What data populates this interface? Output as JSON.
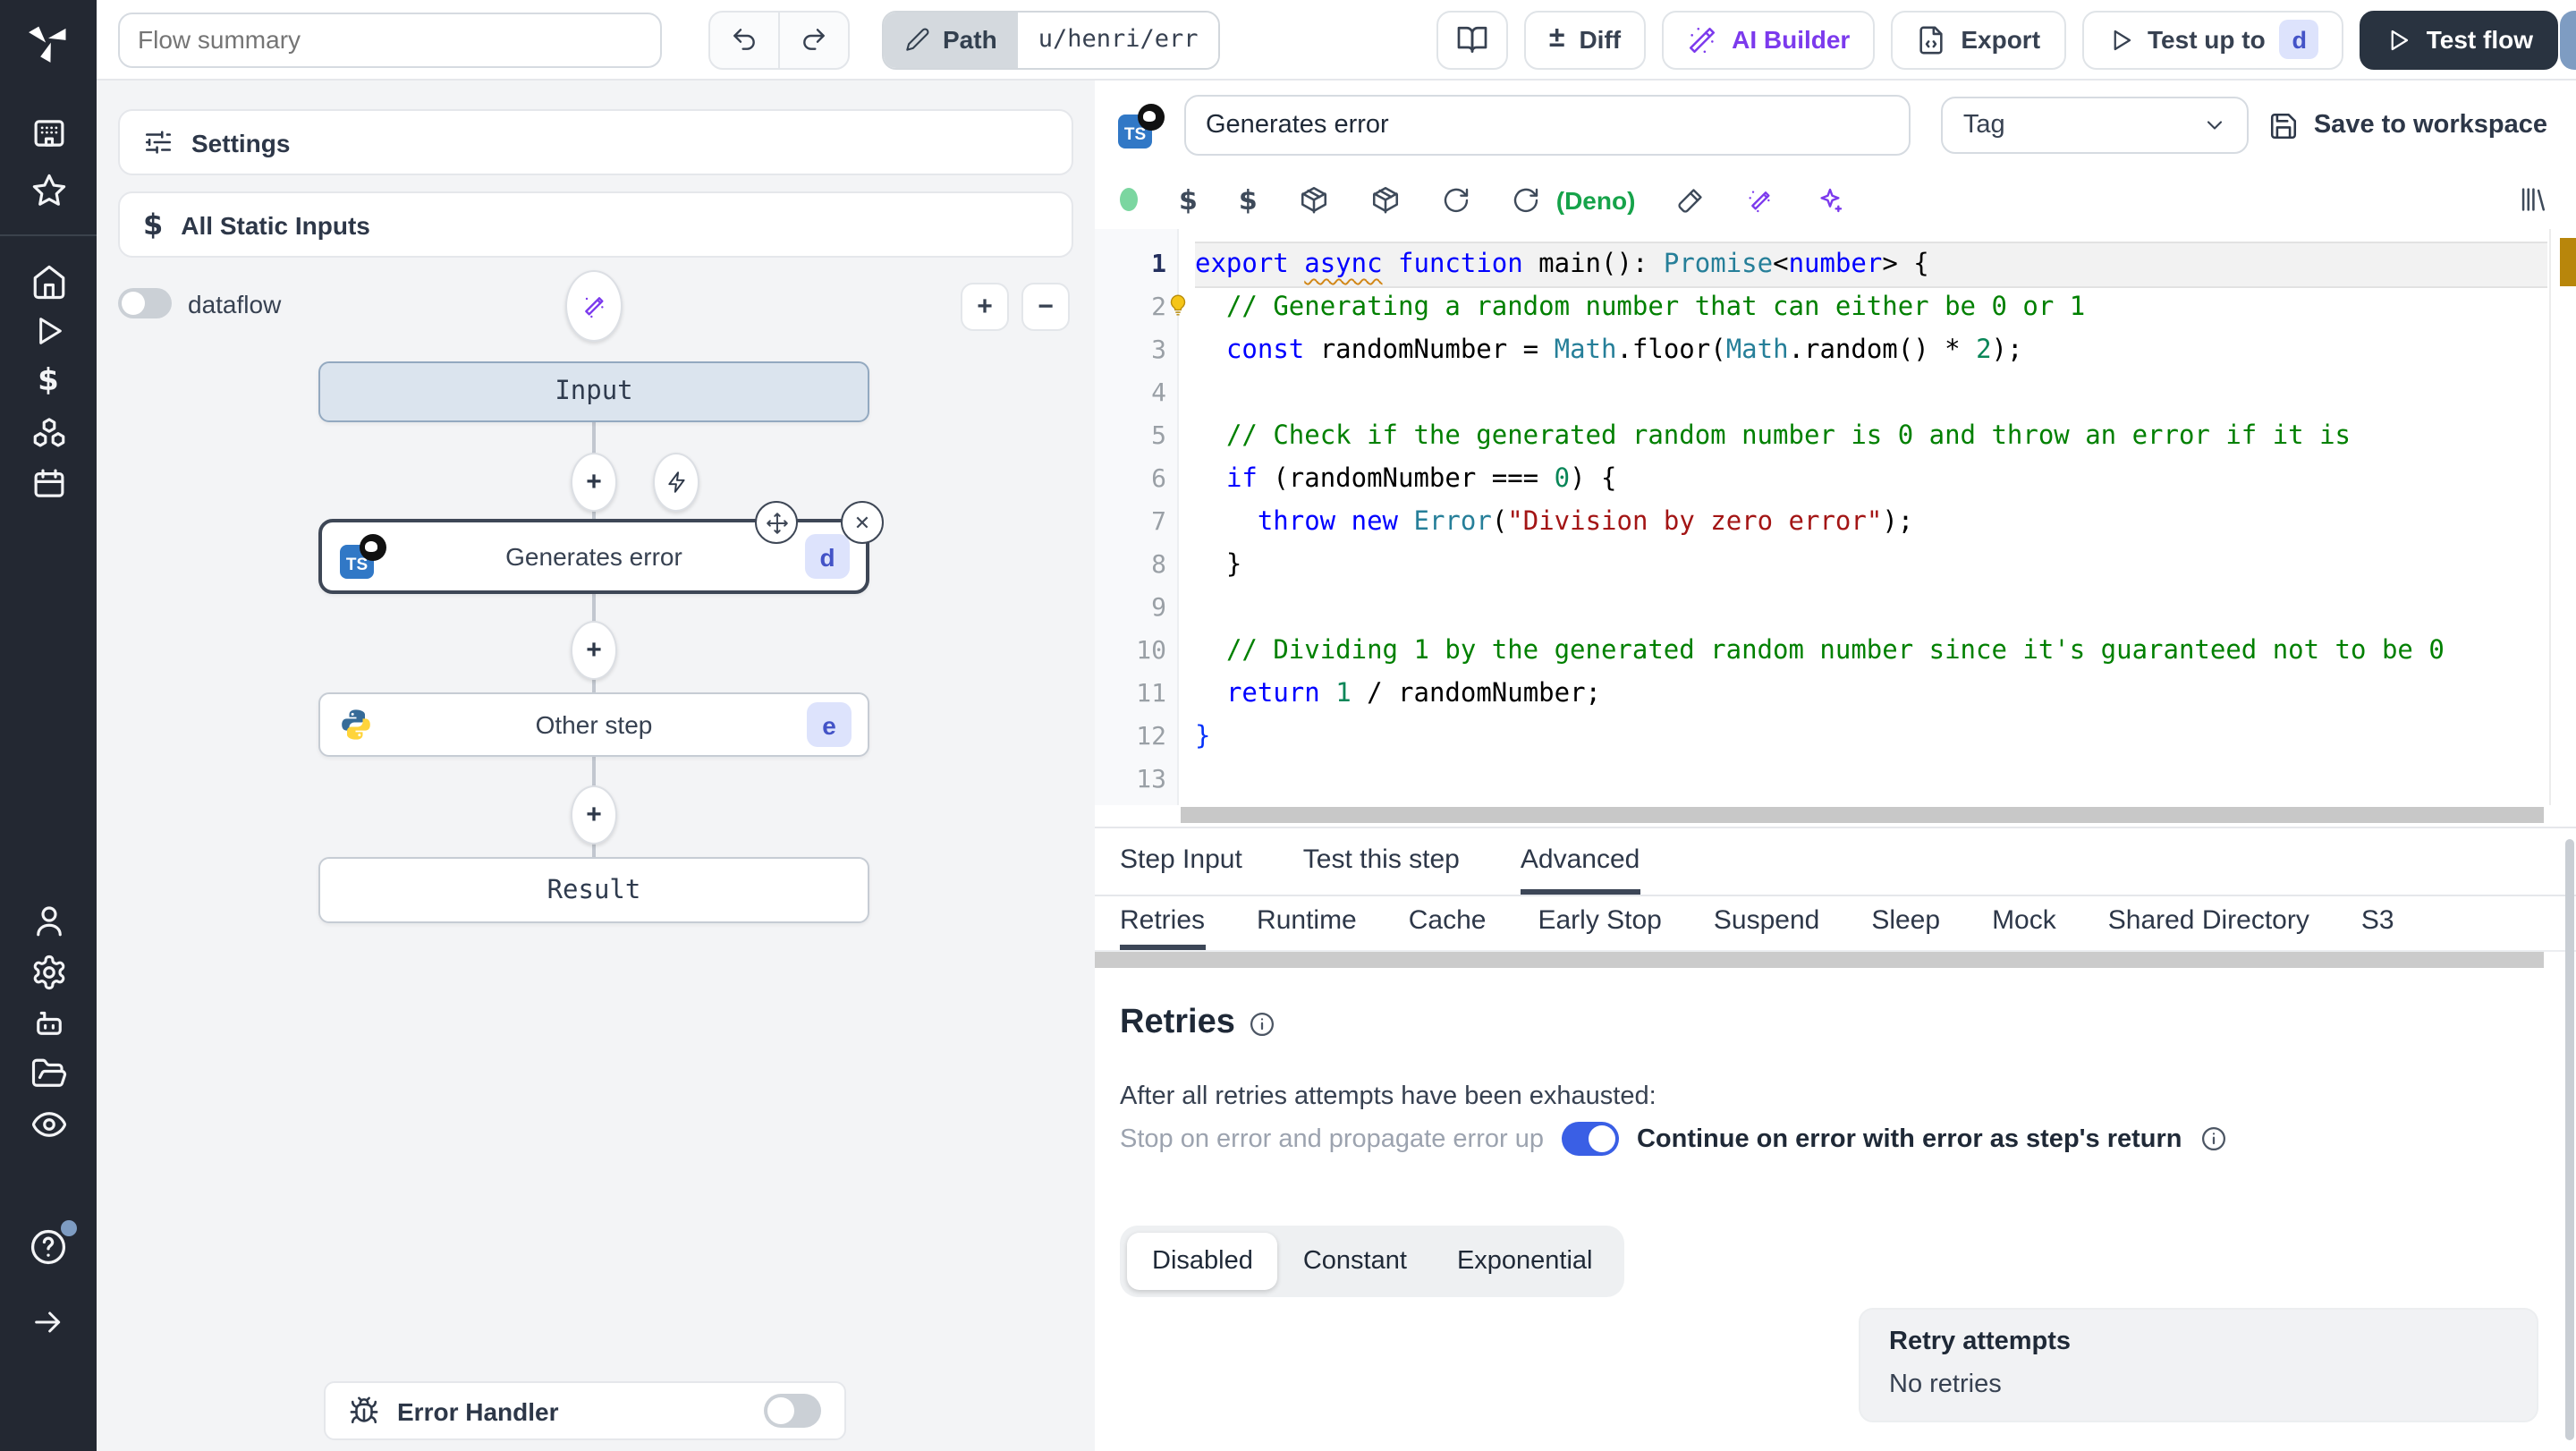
{
  "topbar": {
    "flow_summary_placeholder": "Flow summary",
    "path_label": "Path",
    "path_value": "u/henri/err",
    "diff_label": "Diff",
    "ai_builder_label": "AI Builder",
    "export_label": "Export",
    "test_up_to_label": "Test up to",
    "test_up_to_badge": "d",
    "test_flow_label": "Test flow"
  },
  "icons": {
    "diff_glyph": "±",
    "plus_glyph": "+",
    "minus_glyph": "−",
    "close_glyph": "✕",
    "help_glyph": "?",
    "dollar_glyph": "$"
  },
  "flow_panel": {
    "settings_label": "Settings",
    "static_inputs_label": "All Static Inputs",
    "dataflow_label": "dataflow",
    "nodes": {
      "input_label": "Input",
      "step1_label": "Generates error",
      "step1_badge": "d",
      "step1_lang": "TS",
      "step2_label": "Other step",
      "step2_badge": "e",
      "result_label": "Result"
    },
    "error_handler_label": "Error Handler"
  },
  "step_editor": {
    "lang_badge": "TS",
    "name_value": "Generates error",
    "tag_placeholder": "Tag",
    "save_label": "Save to workspace",
    "runtime_label": "(Deno)",
    "code": {
      "lines": [
        [
          [
            "kw",
            "export"
          ],
          [
            "pl",
            " "
          ],
          [
            "kw warn",
            "async"
          ],
          [
            "pl",
            " "
          ],
          [
            "kw",
            "function"
          ],
          [
            "pl",
            " main"
          ],
          [
            "pl",
            "(): "
          ],
          [
            "ty",
            "Promise"
          ],
          [
            "pl",
            "<"
          ],
          [
            "kw",
            "number"
          ],
          [
            "pl",
            "> {"
          ]
        ],
        [
          [
            "pl",
            "  "
          ],
          [
            "cm",
            "// Generating a random number that can either be 0 or 1"
          ]
        ],
        [
          [
            "pl",
            "  "
          ],
          [
            "kw",
            "const"
          ],
          [
            "pl",
            " randomNumber = "
          ],
          [
            "ty",
            "Math"
          ],
          [
            "pl",
            ".floor("
          ],
          [
            "ty",
            "Math"
          ],
          [
            "pl",
            ".random() * "
          ],
          [
            "nu",
            "2"
          ],
          [
            "pl",
            ");"
          ]
        ],
        [],
        [
          [
            "pl",
            "  "
          ],
          [
            "cm",
            "// Check if the generated random number is 0 and throw an error if it is"
          ]
        ],
        [
          [
            "pl",
            "  "
          ],
          [
            "kw",
            "if"
          ],
          [
            "pl",
            " (randomNumber === "
          ],
          [
            "nu",
            "0"
          ],
          [
            "pl",
            ") {"
          ]
        ],
        [
          [
            "pl",
            "    "
          ],
          [
            "kw",
            "throw"
          ],
          [
            "pl",
            " "
          ],
          [
            "kw",
            "new"
          ],
          [
            "pl",
            " "
          ],
          [
            "ty",
            "Error"
          ],
          [
            "pl",
            "("
          ],
          [
            "st",
            "\"Division by zero error\""
          ],
          [
            "pl",
            ");"
          ]
        ],
        [
          [
            "pl",
            "  }"
          ]
        ],
        [],
        [
          [
            "pl",
            "  "
          ],
          [
            "cm",
            "// Dividing 1 by the generated random number since it's guaranteed not to be 0"
          ]
        ],
        [
          [
            "pl",
            "  "
          ],
          [
            "kw",
            "return"
          ],
          [
            "pl",
            " "
          ],
          [
            "nu",
            "1"
          ],
          [
            "pl",
            " / randomNumber;"
          ]
        ],
        [
          [
            "br",
            "}"
          ]
        ],
        []
      ]
    }
  },
  "panel_tabs": {
    "items": [
      "Step Input",
      "Test this step",
      "Advanced"
    ],
    "active": "Advanced"
  },
  "advanced_tabs": {
    "items": [
      "Retries",
      "Runtime",
      "Cache",
      "Early Stop",
      "Suspend",
      "Sleep",
      "Mock",
      "Shared Directory",
      "S3"
    ],
    "active": "Retries"
  },
  "retries": {
    "title": "Retries",
    "exhausted_label": "After all retries attempts have been exhausted:",
    "stop_label": "Stop on error and propagate error up",
    "continue_label": "Continue on error with error as step's return",
    "continue_enabled": true,
    "modes": [
      "Disabled",
      "Constant",
      "Exponential"
    ],
    "active_mode": "Disabled",
    "retry_attempts_label": "Retry attempts",
    "retry_attempts_value": "No retries"
  },
  "colors": {
    "accent_purple": "#7c3aed",
    "toggle_on_blue": "#3a5fe5",
    "deno_green": "#16a34a",
    "status_dot_green": "#7bd6a0",
    "warn_marker_gold": "#b8860b",
    "ts_blue": "#3178c6",
    "sidebar_dark": "#232832",
    "test_flow_dark": "#293340"
  }
}
